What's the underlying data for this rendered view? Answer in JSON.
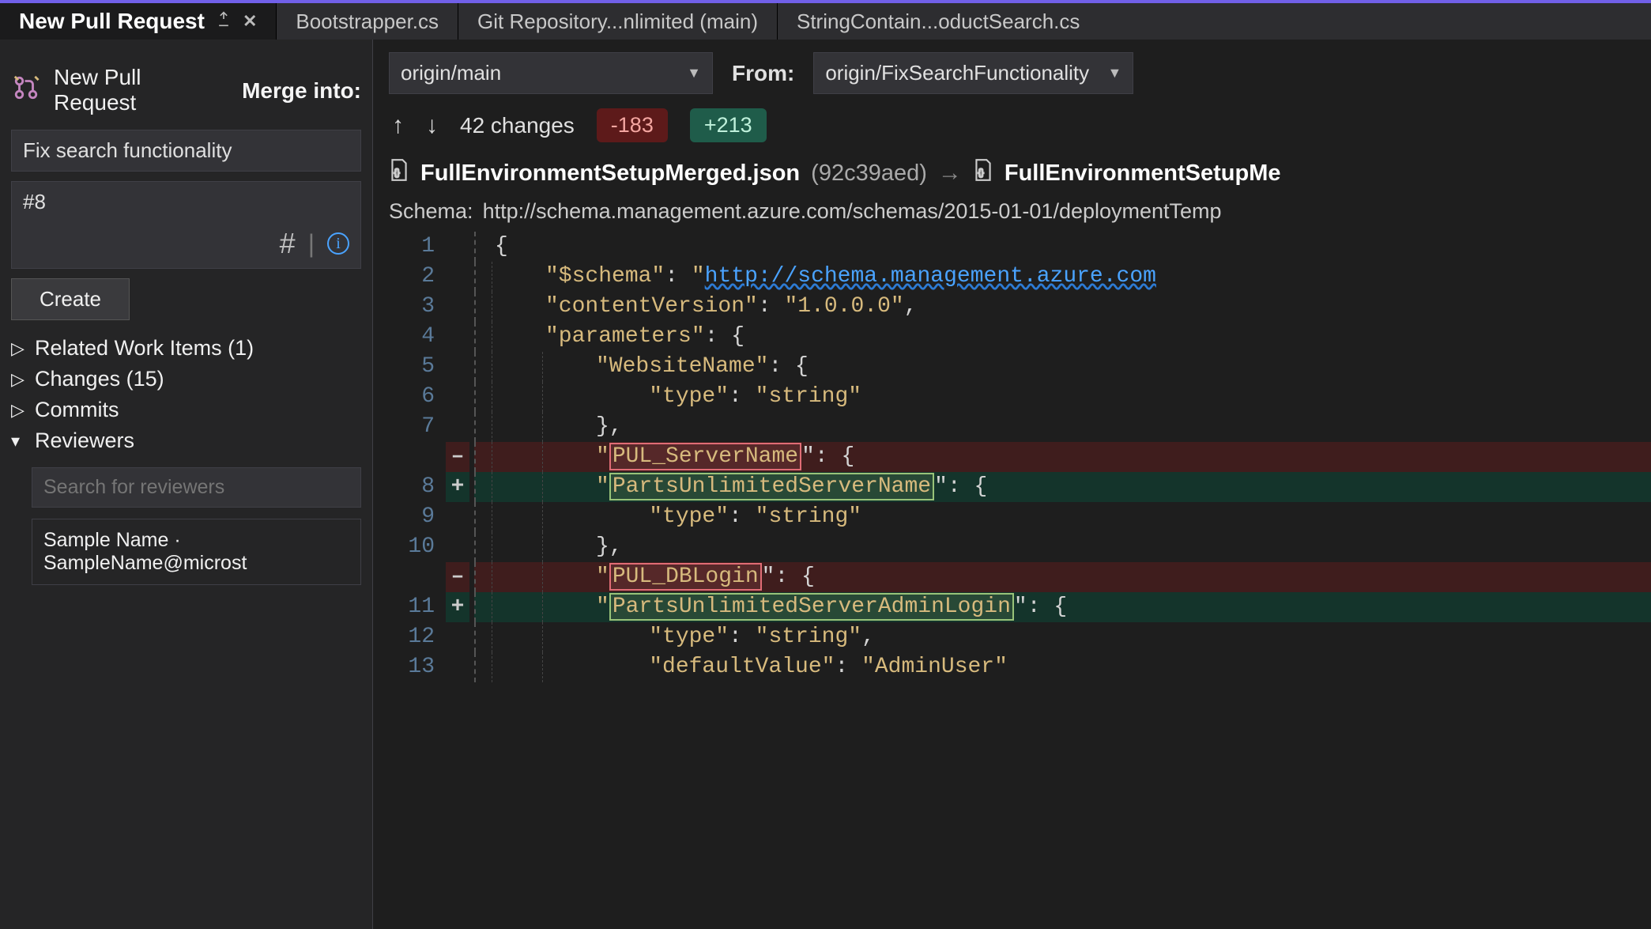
{
  "tabs": {
    "active": "New Pull Request",
    "others": [
      "Bootstrapper.cs",
      "Git Repository...nlimited (main)",
      "StringContain...oductSearch.cs"
    ]
  },
  "pr": {
    "heading": "New Pull Request",
    "merge_label": "Merge into:",
    "merge_branch": "origin/main",
    "from_label": "From:",
    "from_branch": "origin/FixSearchFunctionality",
    "title_value": "Fix search functionality",
    "desc_value": "#8",
    "hash_glyph": "#",
    "pipe_glyph": "|",
    "create_label": "Create"
  },
  "sections": {
    "related": "Related Work Items (1)",
    "changes": "Changes (15)",
    "commits": "Commits",
    "reviewers": "Reviewers",
    "reviewer_search_placeholder": "Search for reviewers",
    "reviewer_entry": "Sample Name · SampleName@microst"
  },
  "stats": {
    "changes_text": "42 changes",
    "removed": "-183",
    "added": "+213"
  },
  "file": {
    "left_name": "FullEnvironmentSetupMerged.json",
    "left_hash": "(92c39aed)",
    "arrow": "→",
    "right_name": "FullEnvironmentSetupMe"
  },
  "schema": {
    "label": "Schema:",
    "value": "http://schema.management.azure.com/schemas/2015-01-01/deploymentTemp"
  },
  "code": {
    "l1": "{",
    "l2a": "\"$schema\"",
    "l2b": ": ",
    "l2c": "\"",
    "l2d": "http://schema.management.azure.com",
    "l3a": "\"contentVersion\"",
    "l3b": ": ",
    "l3c": "\"1.0.0.0\"",
    "l3d": ",",
    "l4a": "\"parameters\"",
    "l4b": ": {",
    "l5a": "\"WebsiteName\"",
    "l5b": ": {",
    "l6a": "\"type\"",
    "l6b": ": ",
    "l6c": "\"string\"",
    "l7": "},",
    "r1q": "\"",
    "r1k": "PUL_ServerName",
    "r1b": "\": {",
    "a1q": "\"",
    "a1k": "PartsUnlimitedServerName",
    "a1b": "\": {",
    "l9a": "\"type\"",
    "l9b": ": ",
    "l9c": "\"string\"",
    "l10": "},",
    "r2q": "\"",
    "r2k": "PUL_DBLogin",
    "r2b": "\": {",
    "a2q": "\"",
    "a2k": "PartsUnlimitedServerAdminLogin",
    "a2b": "\": {",
    "l12a": "\"type\"",
    "l12b": ": ",
    "l12c": "\"string\"",
    "l12d": ",",
    "l13a": "\"defaultValue\"",
    "l13b": ": ",
    "l13c": "\"AdminUser\""
  },
  "linenos": {
    "n1": "1",
    "n2": "2",
    "n3": "3",
    "n4": "4",
    "n5": "5",
    "n6": "6",
    "n7": "7",
    "n8": "8",
    "n9": "9",
    "n10": "10",
    "n11": "11",
    "n12": "12",
    "n13": "13"
  },
  "diff": {
    "minus": "–",
    "plus": "+"
  }
}
